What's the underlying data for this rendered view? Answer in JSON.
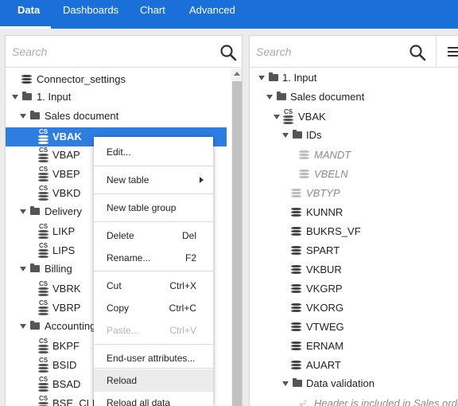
{
  "tabs": [
    {
      "label": "Data"
    },
    {
      "label": "Dashboards"
    },
    {
      "label": "Chart"
    },
    {
      "label": "Advanced"
    }
  ],
  "left_panel": {
    "search_placeholder": "Search",
    "tree": [
      {
        "label": "Connector_settings",
        "icon": "database-icon"
      },
      {
        "label": "1. Input",
        "icon": "folder-icon"
      },
      {
        "label": "Sales document",
        "icon": "folder-icon"
      },
      {
        "label": "VBAK",
        "icon": "cs-table-icon",
        "selected": true
      },
      {
        "label": "VBAP",
        "icon": "cs-table-icon"
      },
      {
        "label": "VBEP",
        "icon": "cs-table-icon"
      },
      {
        "label": "VBKD",
        "icon": "cs-table-icon"
      },
      {
        "label": "Delivery",
        "icon": "folder-icon"
      },
      {
        "label": "LIKP",
        "icon": "cs-table-icon"
      },
      {
        "label": "LIPS",
        "icon": "cs-table-icon"
      },
      {
        "label": "Billing",
        "icon": "folder-icon"
      },
      {
        "label": "VBRK",
        "icon": "cs-table-icon"
      },
      {
        "label": "VBRP",
        "icon": "cs-table-icon"
      },
      {
        "label": "Accounting",
        "icon": "folder-icon"
      },
      {
        "label": "BKPF",
        "icon": "cs-table-icon"
      },
      {
        "label": "BSID",
        "icon": "cs-table-icon"
      },
      {
        "label": "BSAD",
        "icon": "cs-table-icon"
      },
      {
        "label": "BSE_CLR",
        "icon": "cs-table-icon"
      }
    ]
  },
  "context_menu": {
    "items": [
      {
        "label": "Edit...",
        "shortcut": ""
      },
      {
        "label": "New table",
        "shortcut": ""
      },
      {
        "label": "New table group",
        "shortcut": ""
      },
      {
        "label": "Delete",
        "shortcut": "Del"
      },
      {
        "label": "Rename...",
        "shortcut": "F2"
      },
      {
        "label": "Cut",
        "shortcut": "Ctrl+X"
      },
      {
        "label": "Copy",
        "shortcut": "Ctrl+C"
      },
      {
        "label": "Paste...",
        "shortcut": "Ctrl+V",
        "disabled": true
      },
      {
        "label": "End-user attributes...",
        "shortcut": ""
      },
      {
        "label": "Reload",
        "shortcut": ""
      },
      {
        "label": "Reload all data",
        "shortcut": ""
      }
    ]
  },
  "right_panel": {
    "search_placeholder": "Search",
    "tree": [
      {
        "label": "1. Input",
        "icon": "folder-icon"
      },
      {
        "label": "Sales document",
        "icon": "folder-icon"
      },
      {
        "label": "VBAK",
        "icon": "cs-table-icon"
      },
      {
        "label": "IDs",
        "icon": "folder-icon"
      },
      {
        "label": "MANDT",
        "icon": "field-icon",
        "italic": true
      },
      {
        "label": "VBELN",
        "icon": "field-icon",
        "italic": true
      },
      {
        "label": "VBTYP",
        "icon": "field-icon",
        "italic": true
      },
      {
        "label": "KUNNR",
        "icon": "field-icon"
      },
      {
        "label": "BUKRS_VF",
        "icon": "field-icon"
      },
      {
        "label": "SPART",
        "icon": "field-icon"
      },
      {
        "label": "VKBUR",
        "icon": "field-icon"
      },
      {
        "label": "VKGRP",
        "icon": "field-icon"
      },
      {
        "label": "VKORG",
        "icon": "field-icon"
      },
      {
        "label": "VTWEG",
        "icon": "field-icon"
      },
      {
        "label": "ERNAM",
        "icon": "field-icon"
      },
      {
        "label": "AUART",
        "icon": "field-icon"
      },
      {
        "label": "Data validation",
        "icon": "folder-icon"
      },
      {
        "label": "Header is included in Sales order ...",
        "icon": "formula-icon",
        "italic": true
      }
    ]
  },
  "colors": {
    "accent": "#1a6fd9",
    "selection": "#2e7de1"
  }
}
